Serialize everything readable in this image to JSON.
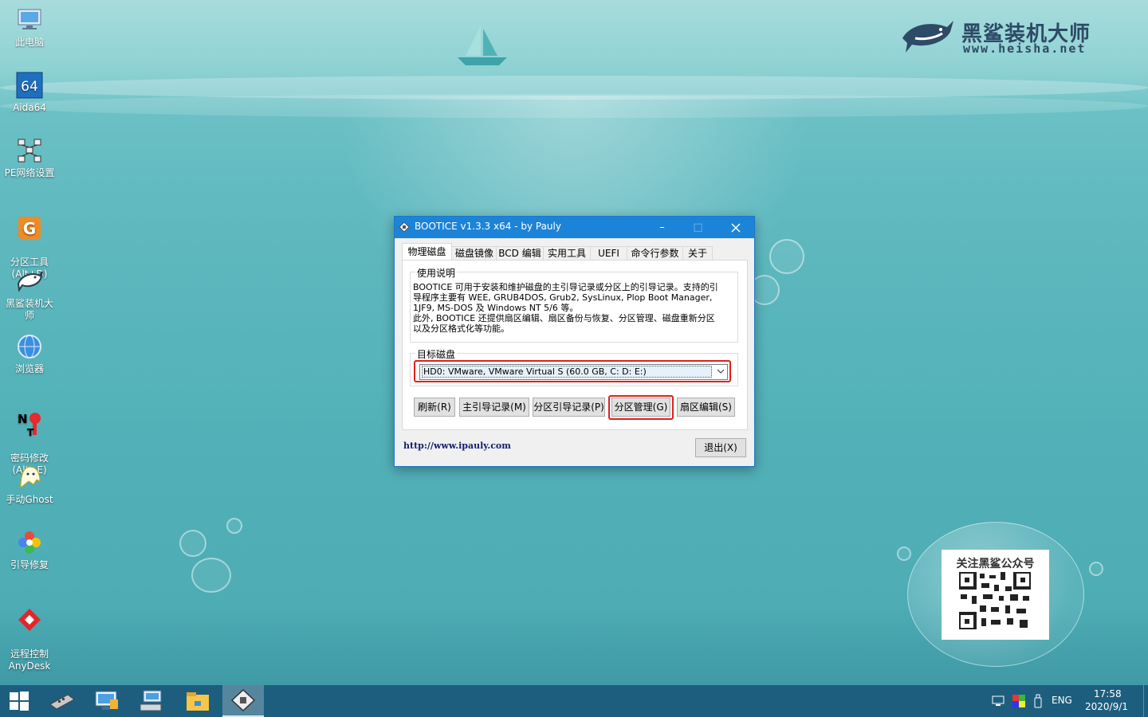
{
  "desktop": {
    "icons": [
      {
        "label": "此电脑",
        "icon": "computer-icon"
      },
      {
        "label": "Aida64",
        "icon": "aida64-icon"
      },
      {
        "label": "PE网络设置",
        "icon": "network-icon"
      },
      {
        "label": "分区工具\n(Alt+D)",
        "icon": "partition-tool-icon"
      },
      {
        "label": "黑鲨装机大师",
        "icon": "shark-icon"
      },
      {
        "label": "浏览器",
        "icon": "browser-icon"
      },
      {
        "label": "密码修改\n(Alt+E)",
        "icon": "password-icon"
      },
      {
        "label": "手动Ghost",
        "icon": "ghost-icon"
      },
      {
        "label": "引导修复",
        "icon": "boot-repair-icon"
      },
      {
        "label": "远程控制\nAnyDesk",
        "icon": "anydesk-icon"
      }
    ],
    "logo": {
      "name": "黑鲨装机大师",
      "url": "www.heisha.net"
    },
    "qr": {
      "title": "关注黑鲨公众号"
    }
  },
  "dialog": {
    "title": "BOOTICE v1.3.3 x64 - by Pauly",
    "tabs": [
      "物理磁盘",
      "磁盘镜像",
      "BCD 编辑",
      "实用工具",
      "UEFI",
      "命令行参数",
      "关于"
    ],
    "usage_label": "使用说明",
    "usage_text_1": "BOOTICE 可用于安装和维护磁盘的主引导记录或分区上的引导记录。支持的引导程序主要有 WEE, GRUB4DOS, Grub2, SysLinux, Plop Boot Manager, 1JF9, MS-DOS 及 Windows NT 5/6 等。",
    "usage_text_2": "此外, BOOTICE 还提供扇区编辑、扇区备份与恢复、分区管理、磁盘重新分区以及分区格式化等功能。",
    "target_label": "目标磁盘",
    "target_value": "HD0: VMware, VMware Virtual S (60.0 GB, C: D: E:)",
    "buttons": {
      "refresh": "刷新(R)",
      "mbr": "主引导记录(M)",
      "pbr": "分区引导记录(P)",
      "parts": "分区管理(G)",
      "sector": "扇区编辑(S)",
      "exit": "退出(X)"
    },
    "link": "http://www.ipauly.com"
  },
  "taskbar": {
    "ime": "ENG",
    "time": "17:58",
    "date": "2020/9/1"
  },
  "colors": {
    "accent": "#1c84d8",
    "highlight": "#e0201e",
    "taskbar": "#1d5e7e"
  }
}
